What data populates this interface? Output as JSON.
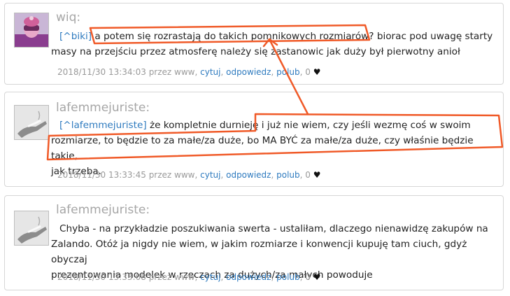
{
  "comments": [
    {
      "username": "wiq:",
      "reply_link": "[^biki]",
      "text_before": "a potem się rozrastają do takich pomnikowych rozmiarów? biorac pod uwagę starty",
      "text_line2": "masy na przejściu przez atmosferę należy się zastanowic jak duży był pierwotny anioł",
      "timestamp": "2018/11/30 13:34:03 przez www,",
      "action_quote": "cytuj",
      "action_reply": "odpowiedz",
      "action_like": "polub",
      "likes": "0",
      "heart": "♥"
    },
    {
      "username": "lafemmejuriste:",
      "reply_link": "[^lafemmejuriste]",
      "text_line1": "że kompletnie durnieję i już nie wiem, czy jeśli wezmę coś w swoim",
      "text_line2": "rozmiarze, to będzie to za małe/za duże, bo MA BYĆ za małe/za duże, czy właśnie będzie takie,",
      "text_line3": "jak trzeba.",
      "timestamp": "2018/11/30 13:33:45 przez www,",
      "action_quote": "cytuj",
      "action_reply": "odpowiedz",
      "action_like": "polub",
      "likes": "0",
      "heart": "♥"
    },
    {
      "username": "lafemmejuriste:",
      "text_line1": "Chyba - na przykładzie poszukiwania swerta - ustaliłam, dlaczego nienawidzę zakupów na",
      "text_line2": "Zalando. Otóż ja nigdy nie wiem, w jakim rozmiarze i konwencji kupuję tam ciuch, gdyż obyczaj",
      "text_line3": "prezentowania modelek w rzeczach za dużych/za małych powoduje",
      "timestamp": "2018/11/30 13:33:08 przez www,",
      "action_quote": "cytuj",
      "action_reply": "odpowiedz",
      "action_like": "polub",
      "likes": "0",
      "heart": "♥"
    }
  ],
  "colors": {
    "annotation": "#f05a28",
    "link": "#2f7bbf",
    "username": "#a6a6a6"
  }
}
